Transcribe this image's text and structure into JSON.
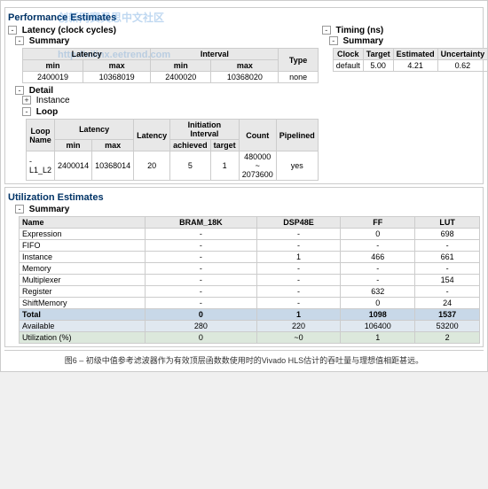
{
  "performance": {
    "title": "Performance Estimates",
    "latency": {
      "title": "Latency (clock cycles)",
      "summary": {
        "title": "Summary",
        "columns": {
          "latency": "Latency",
          "interval": "Interval",
          "min_label": "min",
          "max_label": "max",
          "type_label": "Type"
        },
        "row": {
          "lat_min": "2400019",
          "lat_max": "10368019",
          "int_min": "2400020",
          "int_max": "10368020",
          "type": "none"
        }
      },
      "detail": {
        "title": "Detail",
        "instance": {
          "title": "Instance"
        },
        "loop": {
          "title": "Loop",
          "columns": {
            "name": "Loop Name",
            "lat_min": "min",
            "lat_max": "max",
            "latency": "Latency",
            "ii_achieved": "achieved",
            "ii_target": "target",
            "count": "Count",
            "pipelined": "Pipelined"
          },
          "headers_group": {
            "latency": "Latency",
            "initiation_interval": "Initiation Interval"
          },
          "row": {
            "name": "- L1_L2",
            "lat_min": "2400014",
            "lat_max": "10368014",
            "latency": "20",
            "ii_achieved": "5",
            "ii_target": "1",
            "count": "480000 ~ 2073600",
            "pipelined": "yes"
          }
        }
      }
    },
    "timing": {
      "title": "Timing (ns)",
      "summary": {
        "title": "Summary",
        "columns": {
          "clock": "Clock",
          "target": "Target",
          "estimated": "Estimated",
          "uncertainty": "Uncertainty"
        },
        "row": {
          "clock": "default",
          "target": "5.00",
          "estimated": "4.21",
          "uncertainty": "0.62"
        }
      }
    }
  },
  "utilization": {
    "title": "Utilization Estimates",
    "summary": {
      "title": "Summary",
      "columns": {
        "name": "Name",
        "bram": "BRAM_18K",
        "dsp": "DSP48E",
        "ff": "FF",
        "lut": "LUT"
      },
      "rows": [
        {
          "name": "Expression",
          "bram": "-",
          "dsp": "-",
          "ff": "0",
          "lut": "698"
        },
        {
          "name": "FIFO",
          "bram": "-",
          "dsp": "-",
          "ff": "-",
          "lut": "-"
        },
        {
          "name": "Instance",
          "bram": "-",
          "dsp": "1",
          "ff": "466",
          "lut": "661"
        },
        {
          "name": "Memory",
          "bram": "-",
          "dsp": "-",
          "ff": "-",
          "lut": "-"
        },
        {
          "name": "Multiplexer",
          "bram": "-",
          "dsp": "-",
          "ff": "-",
          "lut": "154"
        },
        {
          "name": "Register",
          "bram": "-",
          "dsp": "-",
          "ff": "632",
          "lut": "-"
        },
        {
          "name": "ShiftMemory",
          "bram": "-",
          "dsp": "-",
          "ff": "0",
          "lut": "24"
        }
      ],
      "total": {
        "bram": "0",
        "dsp": "1",
        "ff": "1098",
        "lut": "1537"
      },
      "available": {
        "bram": "280",
        "dsp": "220",
        "ff": "106400",
        "lut": "53200"
      },
      "utilization": {
        "bram": "0",
        "dsp": "~0",
        "ff": "1",
        "lut": "2"
      }
    }
  },
  "watermarks": [
    "创新网赛灵思中文社区",
    "http://xilinx.eetrend.com"
  ],
  "caption": "图6 – 初级中值参考滤波器作为有效顶层函数数使用时的Vivado HLS估计的吞吐量与理想值相距甚远。"
}
